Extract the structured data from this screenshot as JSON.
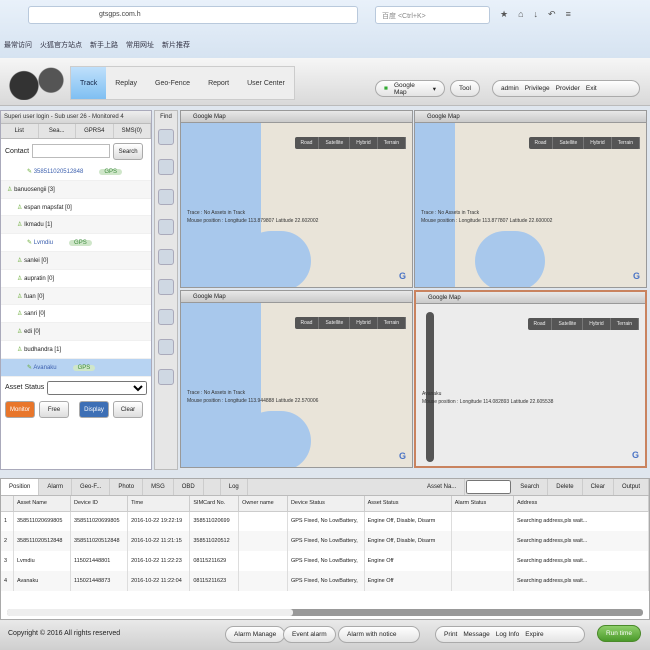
{
  "browser": {
    "url": "gtsgps.com.h",
    "search_placeholder": "百度 <Ctrl+K>",
    "bookmarks": [
      "最常访问",
      "火狐官方站点",
      "新手上路",
      "常用网址",
      "新片推荐"
    ]
  },
  "header": {
    "tabs": [
      "Track",
      "Replay",
      "Geo-Fence",
      "Report",
      "User Center"
    ],
    "map_select": "Google Map",
    "tool": "Tool",
    "user": "admin",
    "privilege": "Privilege",
    "provider": "Provider",
    "exit": "Exit"
  },
  "left": {
    "title": "Superi user login - Sub user 26 - Monitored 4",
    "tabs": [
      "List",
      "Sea...",
      "GPRS4",
      "SMS(0)"
    ],
    "contact_label": "Contact",
    "search_btn": "Search",
    "tree": [
      {
        "label": "358511020512848",
        "gps": "GPS",
        "sel": false,
        "indent": 2
      },
      {
        "label": "banuosengii [3]",
        "indent": 0
      },
      {
        "label": "espan mapsfat [0]",
        "indent": 1
      },
      {
        "label": "Ikmadu [1]",
        "indent": 1
      },
      {
        "label": "Lvmdiu",
        "gps": "GPS",
        "indent": 2
      },
      {
        "label": "sanlei [0]",
        "indent": 1
      },
      {
        "label": "aupratin [0]",
        "indent": 1
      },
      {
        "label": "fuan [0]",
        "indent": 1
      },
      {
        "label": "sanri [0]",
        "indent": 1
      },
      {
        "label": "edi [0]",
        "indent": 1
      },
      {
        "label": "budhandra [1]",
        "indent": 1
      },
      {
        "label": "Avanaku",
        "gps": "GPS",
        "sel": true,
        "indent": 2
      }
    ],
    "asset_status_label": "Asset Status",
    "buttons": [
      "Monitor",
      "Free",
      "Display",
      "Clear"
    ],
    "find": "Find"
  },
  "maps": [
    {
      "title": "Google Map",
      "trace": "Trace : No Assets in Track",
      "mouse": "Mouse position : Longitude 113.879807  Latitude 22.602002"
    },
    {
      "title": "Google Map",
      "trace": "Trace : No Assets in Track",
      "mouse": "Mouse position : Longitude 113.877807  Latitude 22.600002"
    },
    {
      "title": "Google Map",
      "trace": "Trace : No Assets in Track",
      "mouse": "Mouse position : Longitude 113.944888  Latitude 22.570006"
    },
    {
      "title": "Google Map",
      "trace": "Avanaku",
      "mouse": "Mouse position : Longitude 114.082893  Latitude 22.605538"
    }
  ],
  "map_types": [
    "Road",
    "Satellite",
    "Hybrid",
    "Terrain"
  ],
  "grid": {
    "tabs": [
      "Position",
      "Alarm",
      "Geo-F...",
      "Photo",
      "MSG",
      "OBD",
      "",
      "Log"
    ],
    "asset_select": "Asset Na...",
    "actions": [
      "Search",
      "Delete",
      "Clear",
      "Output"
    ],
    "columns": [
      "",
      "Asset Name",
      "Device ID",
      "Time",
      "SIMCard No.",
      "Owner name",
      "Device Status",
      "Asset Status",
      "Alarm Status",
      "Address"
    ],
    "rows": [
      [
        "1",
        "358511020699805",
        "358511020699805",
        "2016-10-22 19:22:19",
        "358511020699",
        "",
        "GPS Fixed, No LowBattery,",
        "Engine Off, Disable, Disarm",
        "",
        "Searching address,pls wait..."
      ],
      [
        "2",
        "358511020512848",
        "358511020512848",
        "2016-10-22 11:21:15",
        "358511020512",
        "",
        "GPS Fixed, No LowBattery,",
        "Engine Off, Disable, Disarm",
        "",
        "Searching address,pls wait..."
      ],
      [
        "3",
        "Lvmdiu",
        "115021448801",
        "2016-10-22 11:22:23",
        "08115211629",
        "",
        "GPS Fixed, No LowBattery,",
        "Engine Off",
        "",
        "Searching address,pls wait..."
      ],
      [
        "4",
        "Avanaku",
        "115021448873",
        "2016-10-22 11:22:04",
        "08115211623",
        "",
        "GPS Fixed, No LowBattery,",
        "Engine Off",
        "",
        "Searching address,pls wait..."
      ]
    ]
  },
  "footer": {
    "copyright": "Copyright © 2016 All rights reserved",
    "alarm_manage": "Alarm Manage",
    "event_alarm": "Event alarm",
    "alarm_select": "Alarm with notice",
    "print": "Print",
    "message": "Message",
    "log_info": "Log Info",
    "expire": "Expire",
    "run_time": "Run time"
  }
}
